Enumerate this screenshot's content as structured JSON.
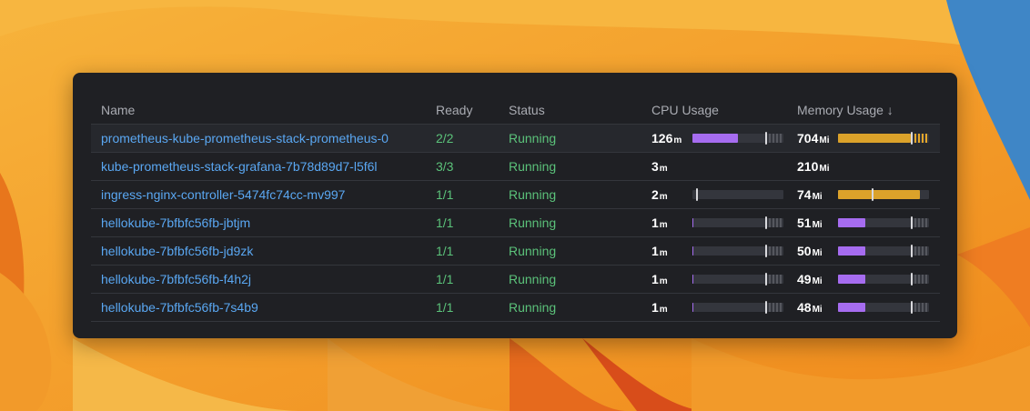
{
  "colors": {
    "accent_link": "#5aa7f2",
    "status_ok": "#5bc27a",
    "bar_purple": "#a66cf0",
    "bar_orange": "#dba22a",
    "panel_bg": "#1f2024"
  },
  "table": {
    "columns": {
      "name": "Name",
      "ready": "Ready",
      "status": "Status",
      "cpu": "CPU Usage",
      "memory": "Memory Usage ↓"
    },
    "rows": [
      {
        "name": "prometheus-kube-prometheus-stack-prometheus-0",
        "ready": "2/2",
        "status": "Running",
        "cpu_value": "126",
        "cpu_unit": "m",
        "cpu_usage": 0.5,
        "cpu_request": 0.8,
        "cpu_limit": 0.0,
        "mem_value": "704",
        "mem_unit": "Mi",
        "mem_usage": 0.8,
        "mem_request": 0.8,
        "mem_limit": 0.0
      },
      {
        "name": "kube-prometheus-stack-grafana-7b78d89d7-l5f6l",
        "ready": "3/3",
        "status": "Running",
        "cpu_value": "3",
        "cpu_unit": "m",
        "mem_value": "210",
        "mem_unit": "Mi"
      },
      {
        "name": "ingress-nginx-controller-5474fc74cc-mv997",
        "ready": "1/1",
        "status": "Running",
        "cpu_value": "2",
        "cpu_unit": "m",
        "cpu_usage": 0.0,
        "cpu_request": 0.04,
        "mem_value": "74",
        "mem_unit": "Mi",
        "mem_usage": 0.9,
        "mem_request": 0.37
      },
      {
        "name": "hellokube-7bfbfc56fb-jbtjm",
        "ready": "1/1",
        "status": "Running",
        "cpu_value": "1",
        "cpu_unit": "m",
        "cpu_usage": 0.01,
        "cpu_request": 0.8,
        "cpu_limit": 0.0,
        "mem_value": "51",
        "mem_unit": "Mi",
        "mem_usage": 0.3,
        "mem_request": 0.8,
        "mem_limit": 0.0
      },
      {
        "name": "hellokube-7bfbfc56fb-jd9zk",
        "ready": "1/1",
        "status": "Running",
        "cpu_value": "1",
        "cpu_unit": "m",
        "cpu_usage": 0.01,
        "cpu_request": 0.8,
        "cpu_limit": 0.0,
        "mem_value": "50",
        "mem_unit": "Mi",
        "mem_usage": 0.3,
        "mem_request": 0.8,
        "mem_limit": 0.0
      },
      {
        "name": "hellokube-7bfbfc56fb-f4h2j",
        "ready": "1/1",
        "status": "Running",
        "cpu_value": "1",
        "cpu_unit": "m",
        "cpu_usage": 0.01,
        "cpu_request": 0.8,
        "cpu_limit": 0.0,
        "mem_value": "49",
        "mem_unit": "Mi",
        "mem_usage": 0.3,
        "mem_request": 0.8,
        "mem_limit": 0.0
      },
      {
        "name": "hellokube-7bfbfc56fb-7s4b9",
        "ready": "1/1",
        "status": "Running",
        "cpu_value": "1",
        "cpu_unit": "m",
        "cpu_usage": 0.01,
        "cpu_request": 0.8,
        "cpu_limit": 0.0,
        "mem_value": "48",
        "mem_unit": "Mi",
        "mem_usage": 0.3,
        "mem_request": 0.8,
        "mem_limit": 0.0
      }
    ]
  }
}
